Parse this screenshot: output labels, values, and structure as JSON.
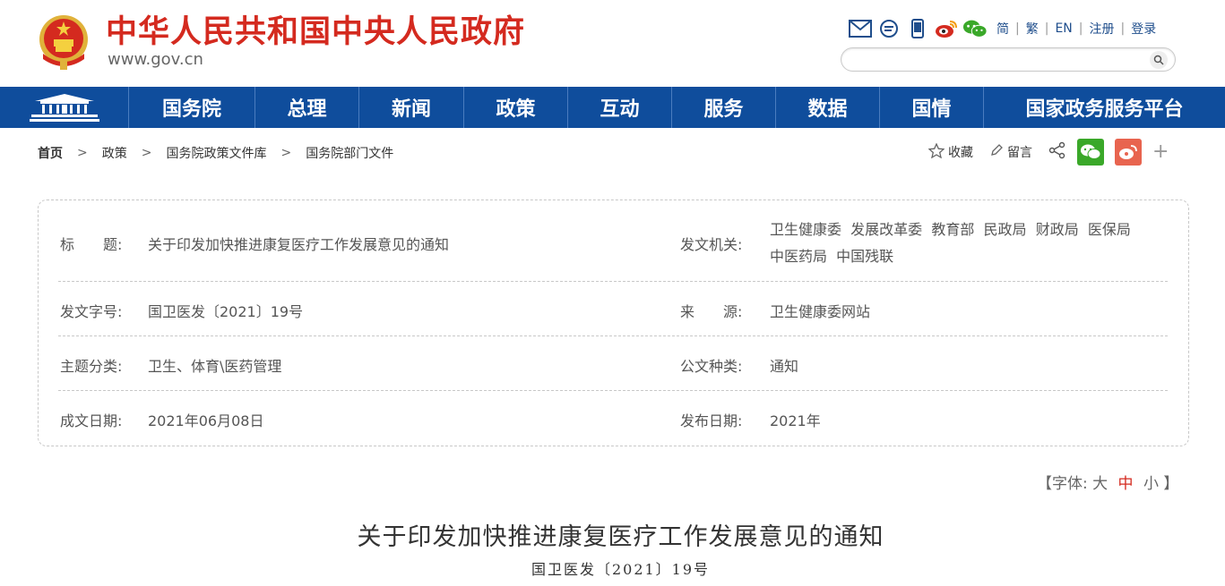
{
  "header": {
    "site_title": "中华人民共和国中央人民政府",
    "site_domain": "www.gov.cn",
    "langs": {
      "simplified": "简",
      "traditional": "繁",
      "english": "EN",
      "register": "注册",
      "login": "登录"
    },
    "search_placeholder": ""
  },
  "nav": {
    "items": [
      "国务院",
      "总理",
      "新闻",
      "政策",
      "互动",
      "服务",
      "数据",
      "国情",
      "国家政务服务平台"
    ]
  },
  "breadcrumb": [
    "首页",
    "政策",
    "国务院政策文件库",
    "国务院部门文件"
  ],
  "share": {
    "favorite": "收藏",
    "comment": "留言",
    "more": "+"
  },
  "info": {
    "title_label": "标　　题:",
    "title_value": "关于印发加快推进康复医疗工作发展意见的通知",
    "issuer_label": "发文机关:",
    "issuer_line1": "卫生健康委  发展改革委  教育部  民政局  财政局  医保局",
    "issuer_line2": "中医药局  中国残联",
    "docno_label": "发文字号:",
    "docno_value": "国卫医发〔2021〕19号",
    "source_label": "来　　源:",
    "source_value": "卫生健康委网站",
    "category_label": "主题分类:",
    "category_value": "卫生、体育\\医药管理",
    "type_label": "公文种类:",
    "type_value": "通知",
    "written_label": "成文日期:",
    "written_value": "2021年06月08日",
    "published_label": "发布日期:",
    "published_value": "2021年"
  },
  "font_size": {
    "prefix": "【字体:",
    "large": "大",
    "medium": "中",
    "small": "小",
    "suffix": "】"
  },
  "article": {
    "title": "关于印发加快推进康复医疗工作发展意见的通知",
    "doc_number": "国卫医发〔2021〕19号"
  },
  "colors": {
    "brand_red": "#d42a1f",
    "nav_blue": "#0f4d9c",
    "link_blue": "#1f4e8c"
  }
}
